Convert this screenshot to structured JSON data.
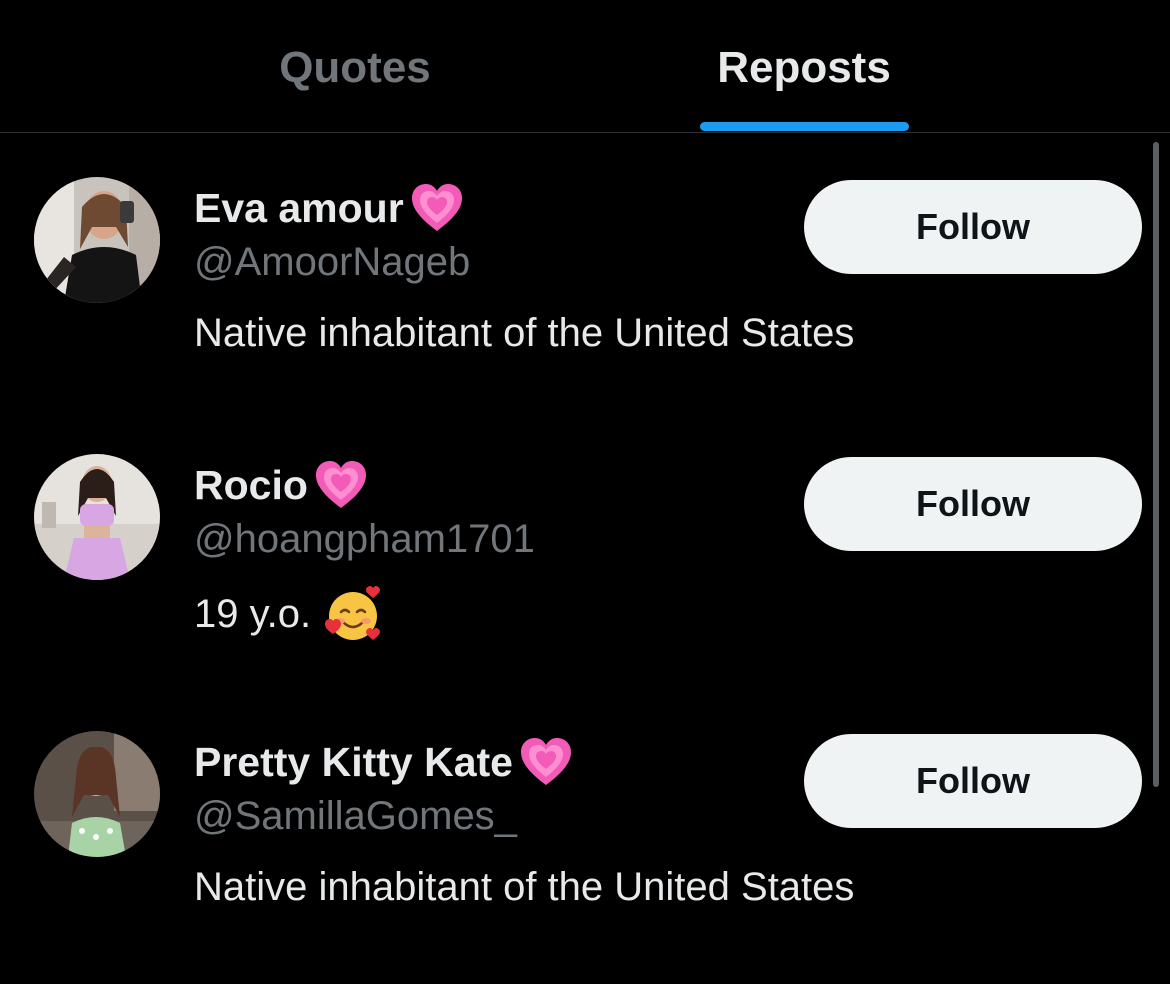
{
  "tabs": {
    "quotes": "Quotes",
    "reposts": "Reposts",
    "active": "reposts"
  },
  "colors": {
    "background": "#000000",
    "accent": "#1d9bf0",
    "primary_text": "#e7e9ea",
    "secondary_text": "#71767b",
    "button_bg": "#eff3f4",
    "button_text": "#0f1419"
  },
  "users": [
    {
      "name": "Eva amour",
      "name_emoji": "growing-heart-emoji",
      "handle": "@AmoorNageb",
      "bio": "Native inhabitant of the United States",
      "follow_label": "Follow"
    },
    {
      "name": "Rocio",
      "name_emoji": "growing-heart-emoji",
      "handle": "@hoangpham1701",
      "bio": "19 y.o.",
      "bio_emoji": "smiling-face-with-hearts-emoji",
      "follow_label": "Follow"
    },
    {
      "name": "Pretty Kitty Kate",
      "name_emoji": "growing-heart-emoji",
      "handle": "@SamillaGomes_",
      "bio": "Native inhabitant of the United States",
      "follow_label": "Follow"
    }
  ]
}
